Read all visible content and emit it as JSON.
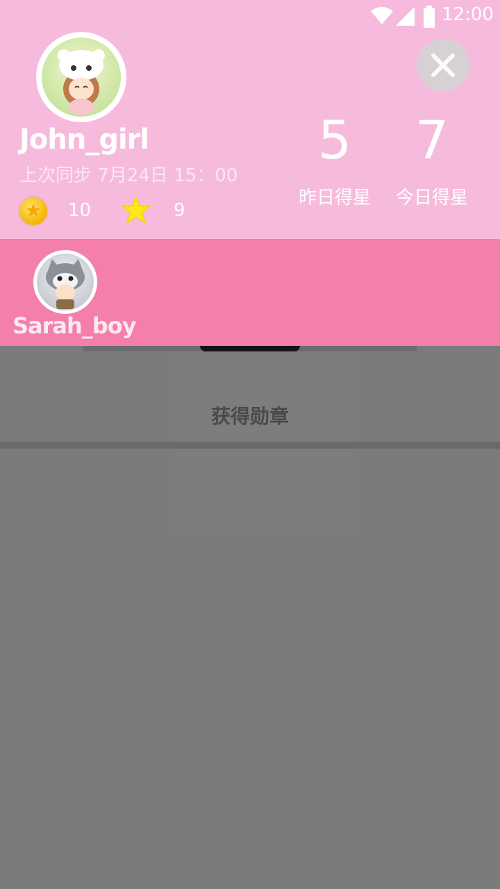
{
  "status_bar": {
    "time": "12:00",
    "icons": [
      "wifi-icon",
      "signal-icon",
      "battery-icon"
    ]
  },
  "profile": {
    "username": "John_girl",
    "last_sync": "上次同步  7月24日  15：00",
    "coins": "10",
    "stars": "9",
    "yesterday_stars": "5",
    "yesterday_label": "昨日得星",
    "today_stars": "7",
    "today_label": "今日得星"
  },
  "second_account": {
    "username": "Sarah_boy"
  },
  "content": {
    "badge_title": "获得勋章"
  },
  "colors": {
    "panel_pink": "#f6bbdc",
    "band_pink": "#f47faa",
    "overlay_gray": "#7b7b7b"
  }
}
